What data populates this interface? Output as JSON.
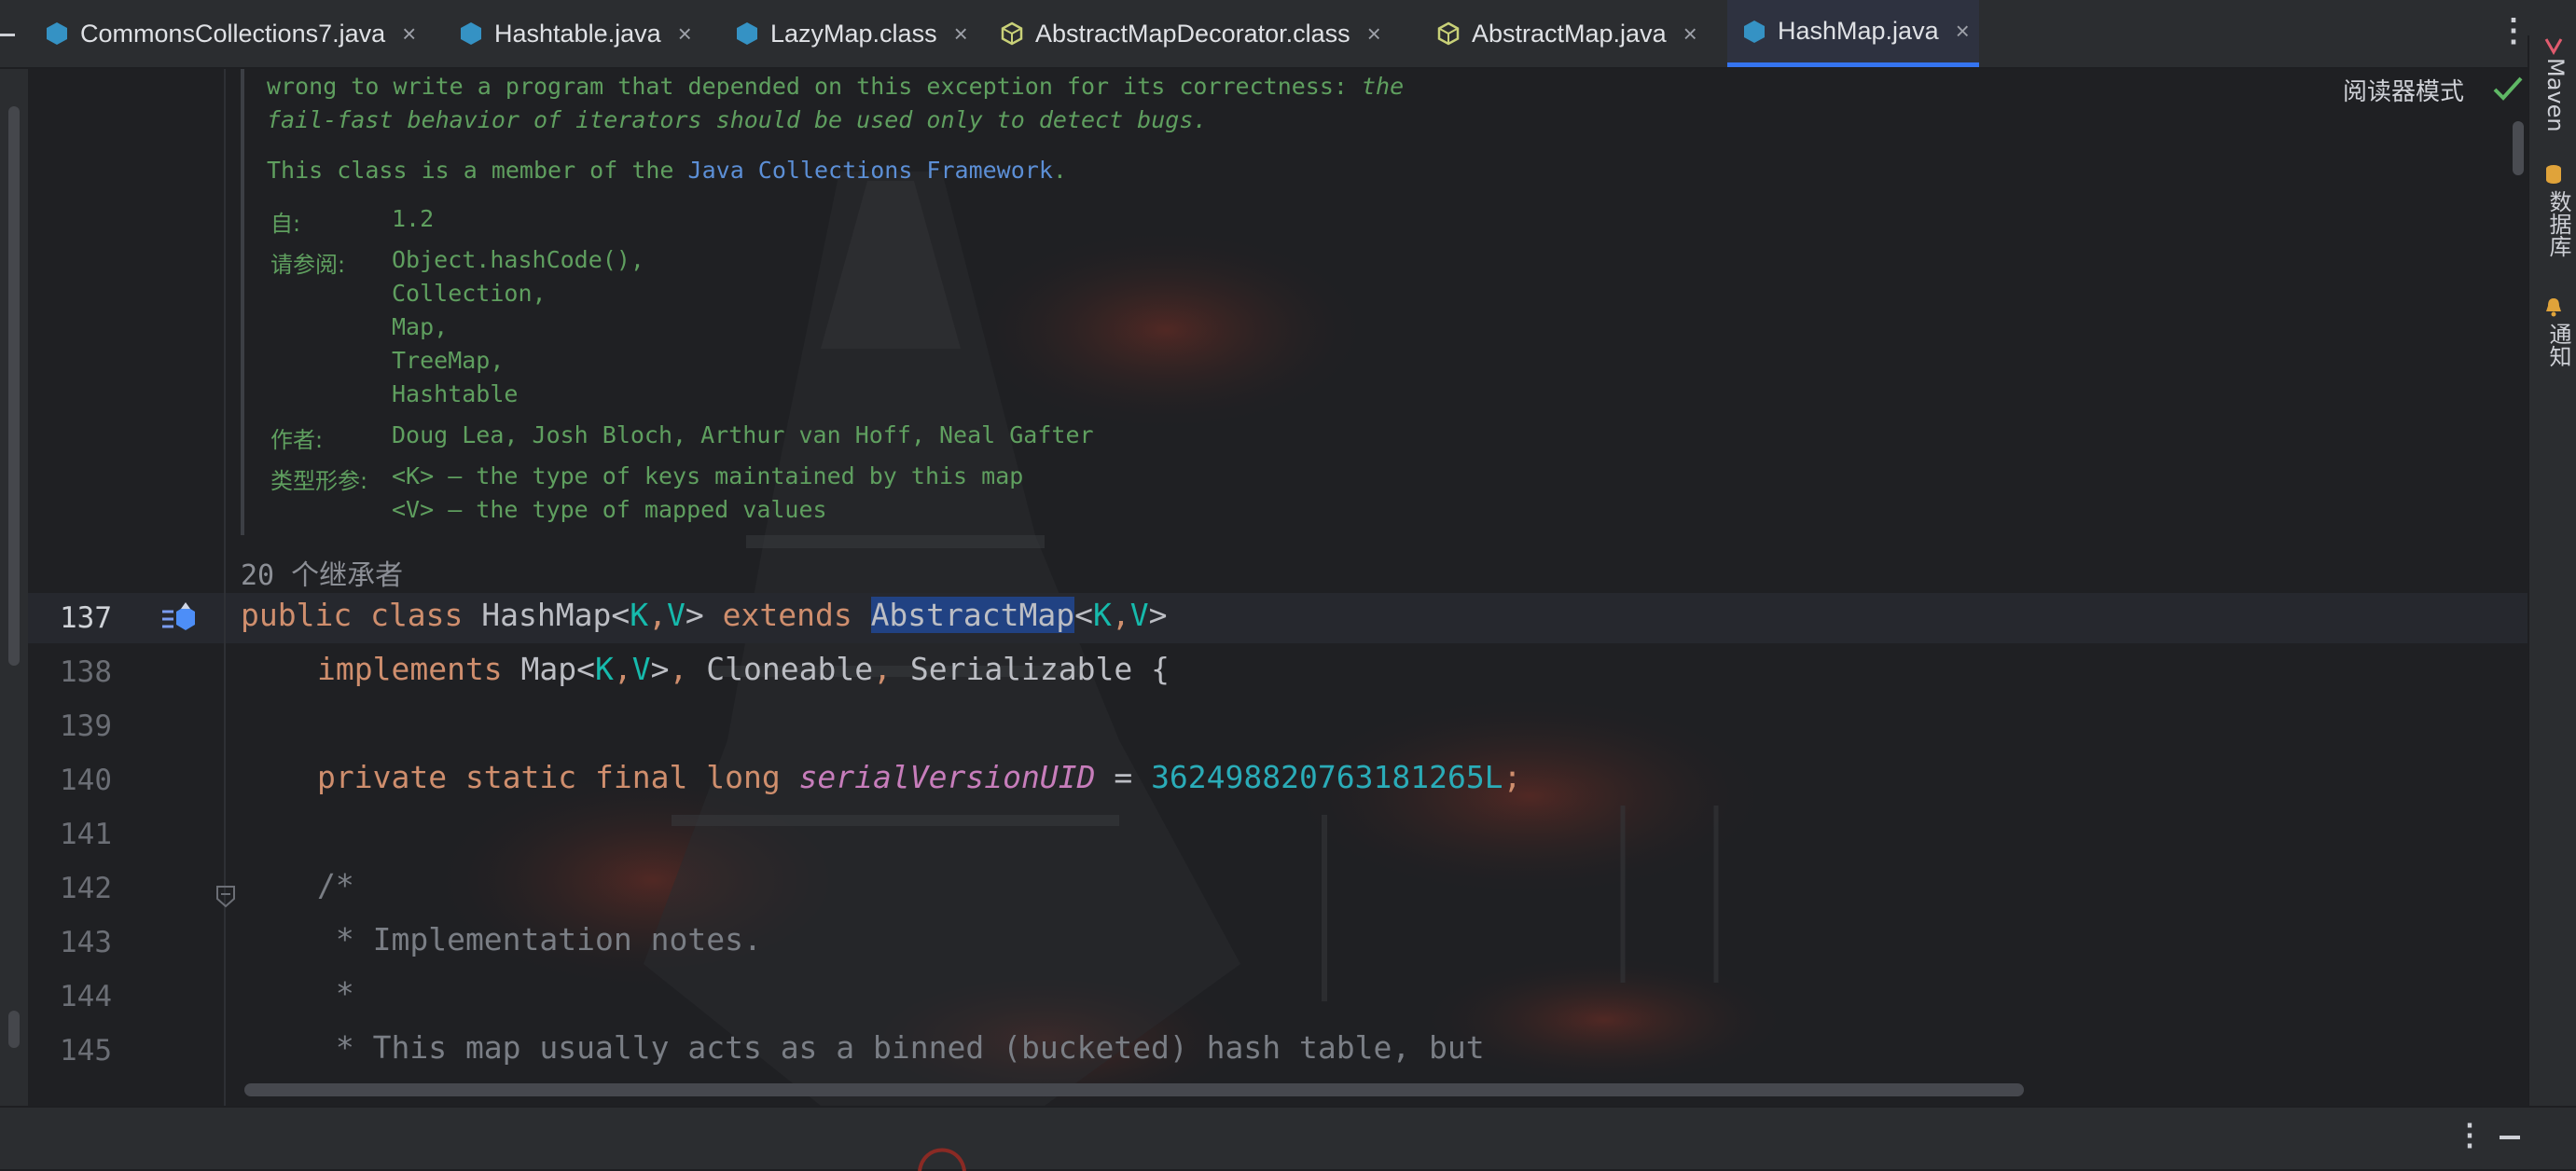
{
  "tabs": [
    {
      "label": "CommonsCollections7.java",
      "icon": "java-class-icon",
      "active": false
    },
    {
      "label": "Hashtable.java",
      "icon": "java-class-icon",
      "active": false
    },
    {
      "label": "LazyMap.class",
      "icon": "java-class-icon",
      "active": false
    },
    {
      "label": "AbstractMapDecorator.class",
      "icon": "abstract-class-icon",
      "active": false
    },
    {
      "label": "AbstractMap.java",
      "icon": "abstract-class-icon",
      "active": false
    },
    {
      "label": "HashMap.java",
      "icon": "java-class-icon",
      "active": true
    }
  ],
  "tab_close": "×",
  "tab_more": "⋮",
  "reader_mode": "阅读器模式",
  "doc": {
    "line1_a": "wrong to write a program that depended on this exception for its correctness: ",
    "line1_b": "the",
    "line2": "fail-fast behavior of iterators should be used only to detect bugs.",
    "member_a": "This class is a member of the ",
    "member_link": "Java Collections Framework",
    "member_b": ".",
    "since_label": "自:",
    "since_value": "1.2",
    "see_label": "请参阅:",
    "see_items": [
      "Object.hashCode(),",
      "Collection,",
      "Map,",
      "TreeMap,",
      "Hashtable"
    ],
    "author_label": "作者:",
    "author_value": "Doug Lea, Josh Bloch, Arthur van Hoff, Neal Gafter",
    "typeparam_label": "类型形参:",
    "typeparam_k": "<K> – the type of keys maintained by this map",
    "typeparam_v": "<V> – the type of mapped values"
  },
  "inheritors": "20 个继承者",
  "line_numbers": [
    "137",
    "138",
    "139",
    "140",
    "141",
    "142",
    "143",
    "144",
    "145"
  ],
  "code": {
    "l137": {
      "kw1": "public class ",
      "name": "HashMap<",
      "k": "K",
      "c": ",",
      "v": "V",
      "g": "> ",
      "kw2": "extends ",
      "sel": "AbstractMap",
      "rest1": "<",
      "k2": "K",
      "c2": ",",
      "v2": "V",
      "rest2": ">"
    },
    "l138": {
      "kw": "implements ",
      "a": "Map<",
      "k": "K",
      "c": ",",
      "v": "V",
      "b": ">",
      "comma1": ", ",
      "clone": "Cloneable",
      "comma2": ", ",
      "ser": "Serializable {"
    },
    "l140": {
      "kw": "private static final long ",
      "fld": "serialVersionUID",
      "eq": " = ",
      "num": "362498820763181265L",
      "semi": ";"
    },
    "l142": "/*",
    "l143": " * Implementation notes.",
    "l144": " *",
    "l145": " * This map usually acts as a binned (bucketed) hash table, but"
  },
  "right_tools": [
    "Maven",
    "数据库",
    "通知"
  ],
  "bottom_more": "⋮",
  "colors": {
    "accent": "#3574f0",
    "keyword": "#cf8e6d",
    "type_param": "#16baac",
    "number": "#2aacb8",
    "field": "#c77dbb",
    "doc": "#5f9f5f"
  }
}
